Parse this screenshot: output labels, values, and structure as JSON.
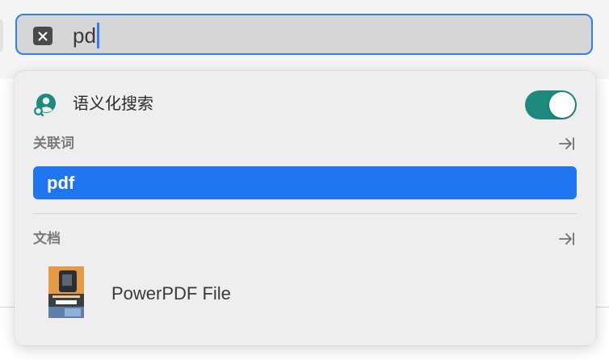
{
  "search": {
    "query": "pd",
    "clear_icon": "close-x-icon"
  },
  "semantic_search": {
    "label": "语义化搜索",
    "icon": "person-search-icon",
    "enabled": true,
    "accent_color": "#1e8a7e"
  },
  "sections": {
    "related_terms": {
      "title": "关联词",
      "arrow_icon": "arrow-to-right-icon",
      "items": [
        {
          "label": "pdf",
          "selected": true
        }
      ]
    },
    "documents": {
      "title": "文档",
      "arrow_icon": "arrow-to-right-icon",
      "items": [
        {
          "name": "PowerPDF File",
          "thumbnail": "document-thumbnail"
        }
      ]
    }
  },
  "colors": {
    "focus_ring": "#2f7ff6",
    "selection": "#1f76f0"
  }
}
